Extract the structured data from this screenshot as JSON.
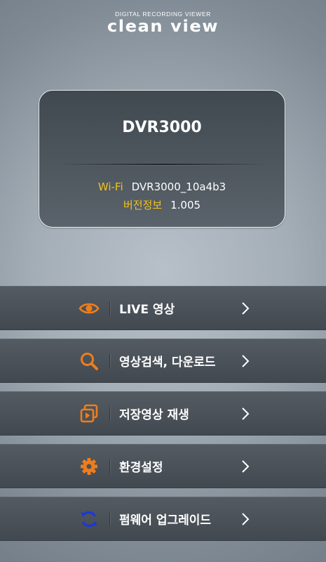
{
  "header": {
    "subtitle": "DIGITAL RECORDING VIEWER",
    "logo": "clean view"
  },
  "device": {
    "name": "DVR3000",
    "wifi_label": "Wi-Fi",
    "wifi_value": "DVR3000_10a4b3",
    "version_label": "버전정보",
    "version_value": "1.005"
  },
  "menu": {
    "items": [
      {
        "label": "LIVE 영상",
        "icon": "eye-icon"
      },
      {
        "label": "영상검색, 다운로드",
        "icon": "search-icon"
      },
      {
        "label": "저장영상 재생",
        "icon": "playback-icon"
      },
      {
        "label": "환경설정",
        "icon": "gear-icon"
      },
      {
        "label": "펌웨어 업그레이드",
        "icon": "refresh-icon"
      }
    ]
  },
  "colors": {
    "accent_orange": "#ef7d1a",
    "accent_blue": "#1e36d8",
    "label_yellow": "#f3c21b"
  }
}
